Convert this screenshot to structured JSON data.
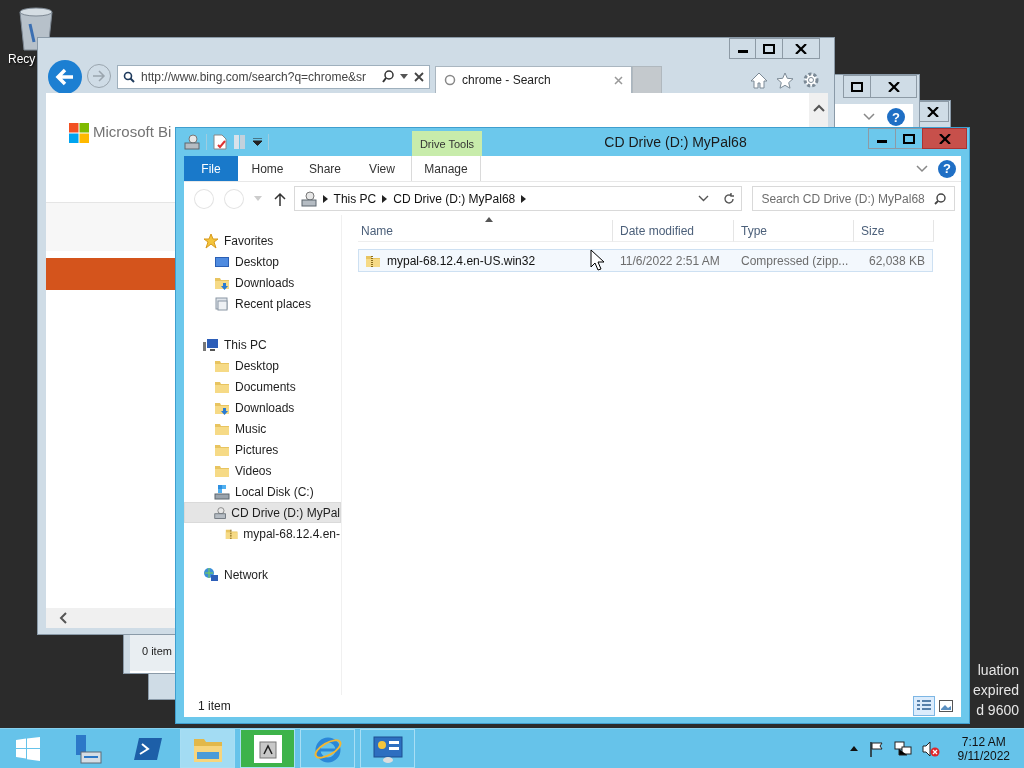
{
  "desktop": {
    "recycle_bin": {
      "label": "Recy"
    },
    "watermark": [
      "luation",
      "expired",
      "d 9600"
    ]
  },
  "back_window": {
    "help": "?",
    "status": "0 item"
  },
  "browser": {
    "address": "http://www.bing.com/search?q=chrome&sr",
    "tabs": [
      {
        "label": "chrome - Search",
        "selected": true
      }
    ],
    "page": {
      "logo": "Microsoft Bi"
    }
  },
  "explorer": {
    "title": "CD Drive (D:) MyPal68",
    "context_tab": "Drive Tools",
    "help": "?",
    "ribbon_tabs": [
      {
        "label": "File",
        "kind": "file"
      },
      {
        "label": "Home",
        "kind": "tab"
      },
      {
        "label": "Share",
        "kind": "tab"
      },
      {
        "label": "View",
        "kind": "tab"
      },
      {
        "label": "Manage",
        "kind": "context"
      }
    ],
    "breadcrumb": [
      "This PC",
      "CD Drive (D:) MyPal68"
    ],
    "search": {
      "placeholder": "Search CD Drive (D:) MyPal68"
    },
    "nav": [
      {
        "label": "Favorites",
        "kind": "favorites",
        "selected": false,
        "children": [
          {
            "label": "Desktop",
            "kind": "desktop",
            "selected": false
          },
          {
            "label": "Downloads",
            "kind": "downloads",
            "selected": false
          },
          {
            "label": "Recent places",
            "kind": "recent",
            "selected": false
          }
        ]
      },
      {
        "label": "This PC",
        "kind": "computer",
        "selected": false,
        "children": [
          {
            "label": "Desktop",
            "kind": "folder",
            "selected": false
          },
          {
            "label": "Documents",
            "kind": "folder",
            "selected": false
          },
          {
            "label": "Downloads",
            "kind": "downloads",
            "selected": false
          },
          {
            "label": "Music",
            "kind": "folder",
            "selected": false
          },
          {
            "label": "Pictures",
            "kind": "folder",
            "selected": false
          },
          {
            "label": "Videos",
            "kind": "folder",
            "selected": false
          },
          {
            "label": "Local Disk (C:)",
            "kind": "drive",
            "selected": false
          },
          {
            "label": "CD Drive (D:) MyPal",
            "kind": "disc",
            "selected": true,
            "children": [
              {
                "label": "mypal-68.12.4.en-",
                "kind": "archive",
                "selected": false
              }
            ]
          }
        ]
      },
      {
        "label": "Network",
        "kind": "network",
        "selected": false
      }
    ],
    "columns": [
      {
        "label": "Name",
        "sorted": true
      },
      {
        "label": "Date modified",
        "sorted": false
      },
      {
        "label": "Type",
        "sorted": false
      },
      {
        "label": "Size",
        "sorted": false
      }
    ],
    "rows": [
      {
        "name": "mypal-68.12.4.en-US.win32",
        "date": "11/6/2022 2:51 AM",
        "type": "Compressed (zipp...",
        "size": "62,038 KB",
        "selected": true
      }
    ],
    "status": "1 item"
  },
  "taskbar": {
    "apps": [
      {
        "kind": "server",
        "running": false,
        "active": false
      },
      {
        "kind": "shell",
        "running": false,
        "active": false
      },
      {
        "kind": "explorer",
        "running": true,
        "active": true
      },
      {
        "kind": "installer",
        "running": true,
        "active": false
      },
      {
        "kind": "browser",
        "running": true,
        "active": false
      },
      {
        "kind": "control",
        "running": true,
        "active": false
      }
    ],
    "clock": {
      "time": "7:12 AM",
      "date": "9/11/2022"
    }
  }
}
